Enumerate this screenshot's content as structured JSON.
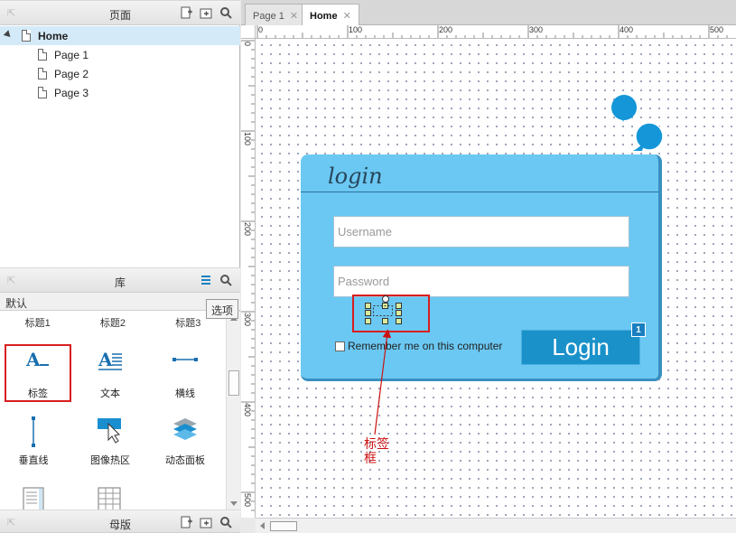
{
  "pages_panel": {
    "title": "页面",
    "tree": [
      {
        "label": "Home",
        "selected": true
      },
      {
        "label": "Page 1"
      },
      {
        "label": "Page 2"
      },
      {
        "label": "Page 3"
      }
    ]
  },
  "library_panel": {
    "title": "库",
    "selected_library": "默认",
    "options_tooltip": "选项",
    "categories": [
      "标题1",
      "标题2",
      "标题3"
    ],
    "widgets": [
      {
        "label": "标签",
        "icon": "label-widget-icon"
      },
      {
        "label": "文本",
        "icon": "text-widget-icon"
      },
      {
        "label": "横线",
        "icon": "horizontal-line-icon"
      },
      {
        "label": "垂直线",
        "icon": "vertical-line-icon"
      },
      {
        "label": "图像热区",
        "icon": "image-hotspot-icon"
      },
      {
        "label": "动态面板",
        "icon": "dynamic-panel-icon"
      },
      {
        "label": "",
        "icon": "inline-frame-icon"
      },
      {
        "label": "",
        "icon": "table-widget-icon"
      }
    ]
  },
  "masters_panel": {
    "title": "母版"
  },
  "tabs": [
    {
      "label": "Page 1",
      "active": false
    },
    {
      "label": "Home",
      "active": true
    }
  ],
  "ruler": {
    "top_labels": [
      "0",
      "100",
      "200",
      "300",
      "400",
      "500"
    ],
    "left_labels": [
      "0",
      "100",
      "200",
      "300",
      "400",
      "500"
    ]
  },
  "login_widget": {
    "title": "login",
    "username_placeholder": "Username",
    "password_placeholder": "Password",
    "remember_label": "Remember me on this computer",
    "button_label": "Login",
    "badge": "1"
  },
  "annotation": {
    "text": "标签框"
  },
  "colors": {
    "card": "#6bc8f3",
    "button": "#1a91c9",
    "highlight": "#d81e1e",
    "selection": "#d4eaf8"
  }
}
